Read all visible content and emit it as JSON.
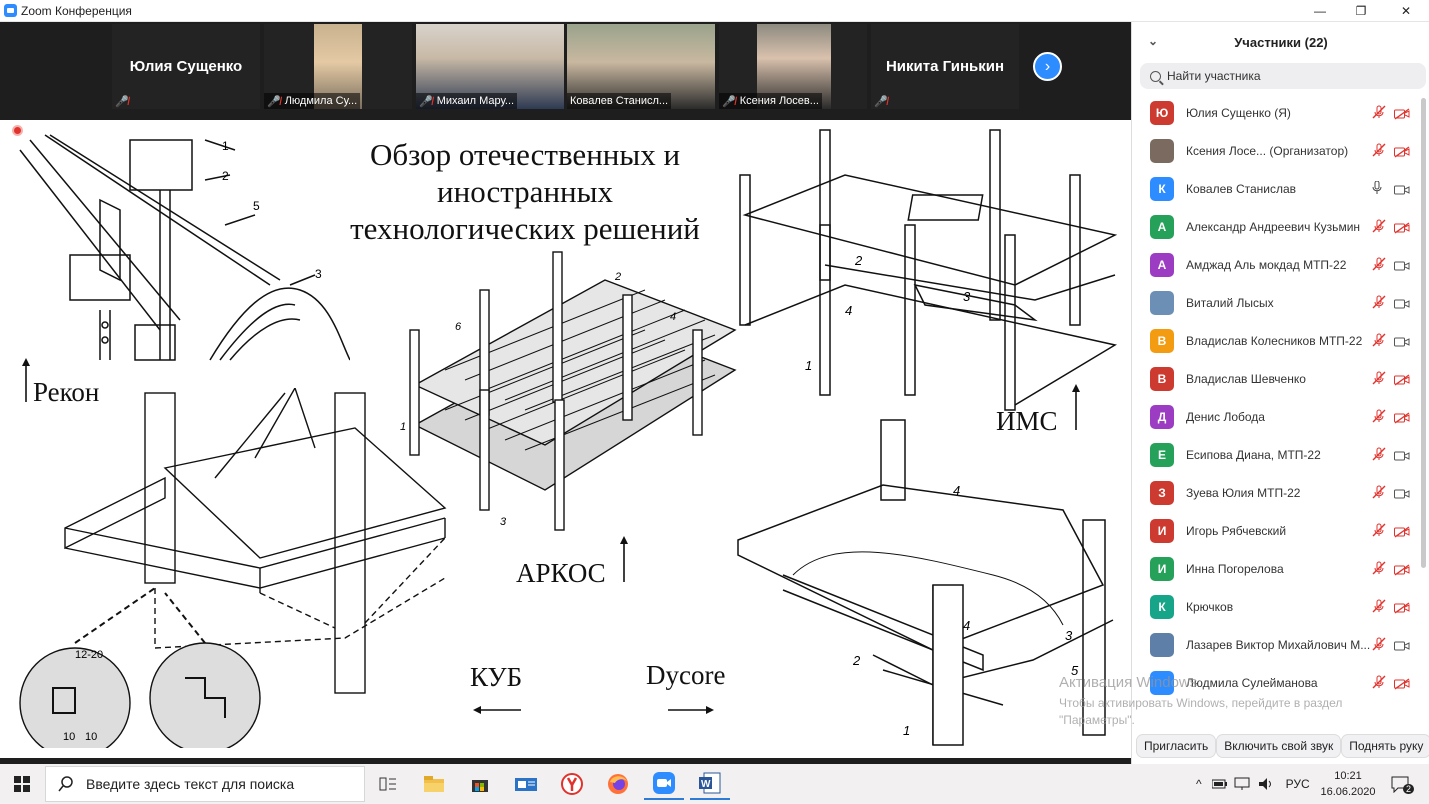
{
  "window": {
    "title": "Zoom Конференция",
    "minimize": "—",
    "maximize": "❐",
    "close": "✕"
  },
  "strip": {
    "tiles": [
      {
        "name": "Юлия Сущенко",
        "caption": ""
      },
      {
        "name": "",
        "caption": "Людмила Су..."
      },
      {
        "name": "",
        "caption": "Михаил Мару..."
      },
      {
        "name": "",
        "caption": "Ковалев Станисл..."
      },
      {
        "name": "",
        "caption": "Ксения Лосев..."
      },
      {
        "name": "Никита Гинькин",
        "caption": ""
      }
    ],
    "next_label": "›"
  },
  "slide": {
    "title_lines": [
      "Обзор отечественных и",
      "иностранных",
      "технологических решений"
    ],
    "labels": {
      "rekon": "Рекон",
      "ims": "ИМС",
      "arkos": "АРКОС",
      "kub": "КУБ",
      "dycore": "Dycore"
    },
    "numbers": {
      "n1": "1",
      "n2": "2",
      "n3": "3",
      "n4": "4",
      "n5": "5",
      "n6": "6",
      "d1": "12-20",
      "d2": "10",
      "d3": "10"
    }
  },
  "participants": {
    "header": "Участники (22)",
    "search_placeholder": "Найти участника",
    "items": [
      {
        "name": "Юлия Сущенко (Я)",
        "initial": "Ю",
        "color": "#cc3a30",
        "mic": "off",
        "cam": "off"
      },
      {
        "name": "Ксения Лосе...  (Организатор)",
        "initial": "",
        "color": "#7a6a60",
        "mic": "off",
        "cam": "off"
      },
      {
        "name": "Ковалев Станислав",
        "initial": "К",
        "color": "#2d8cff",
        "mic": "on",
        "cam": "on"
      },
      {
        "name": "Александр Андреевич Кузьмин",
        "initial": "А",
        "color": "#25a15a",
        "mic": "off",
        "cam": "off"
      },
      {
        "name": "Амджад Аль мокдад МТП-22",
        "initial": "А",
        "color": "#9b3cc2",
        "mic": "off",
        "cam": "on"
      },
      {
        "name": "Виталий Лысых",
        "initial": "",
        "color": "#6c8fb5",
        "mic": "off",
        "cam": "on"
      },
      {
        "name": "Владислав Колесников МТП-22",
        "initial": "В",
        "color": "#f39c12",
        "mic": "off",
        "cam": "on"
      },
      {
        "name": "Владислав Шевченко",
        "initial": "В",
        "color": "#cc3a30",
        "mic": "off",
        "cam": "off"
      },
      {
        "name": "Денис Лобода",
        "initial": "Д",
        "color": "#9b3cc2",
        "mic": "off",
        "cam": "off"
      },
      {
        "name": "Есипова Диана, МТП-22",
        "initial": "Е",
        "color": "#25a15a",
        "mic": "off",
        "cam": "on"
      },
      {
        "name": "Зуева Юлия МТП-22",
        "initial": "З",
        "color": "#cc3a30",
        "mic": "off",
        "cam": "on"
      },
      {
        "name": "Игорь Рябчевский",
        "initial": "И",
        "color": "#cc3a30",
        "mic": "off",
        "cam": "off"
      },
      {
        "name": "Инна Погорелова",
        "initial": "И",
        "color": "#25a15a",
        "mic": "off",
        "cam": "off"
      },
      {
        "name": "Крючков",
        "initial": "К",
        "color": "#17a589",
        "mic": "off",
        "cam": "off"
      },
      {
        "name": "Лазарев Виктор Михайлович М...",
        "initial": "",
        "color": "#5d7fa8",
        "mic": "off",
        "cam": "on"
      },
      {
        "name": "Людмила Сулейманова",
        "initial": "",
        "color": "#2d8cff",
        "mic": "off",
        "cam": "off"
      }
    ],
    "buttons": {
      "invite": "Пригласить",
      "unmute": "Включить свой звук",
      "raise": "Поднять руку"
    }
  },
  "watermark": {
    "line1": "Активация Windows",
    "line2": "Чтобы активировать Windows, перейдите в раздел",
    "line3": "\"Параметры\"."
  },
  "taskbar": {
    "search_placeholder": "Введите здесь текст для поиска",
    "lang": "РУС",
    "time": "10:21",
    "date": "16.06.2020",
    "notif_count": "2"
  },
  "colors": {
    "accent": "#2d8cff",
    "mic_off": "#e0332d",
    "active_speaker": "#8fc43b"
  }
}
